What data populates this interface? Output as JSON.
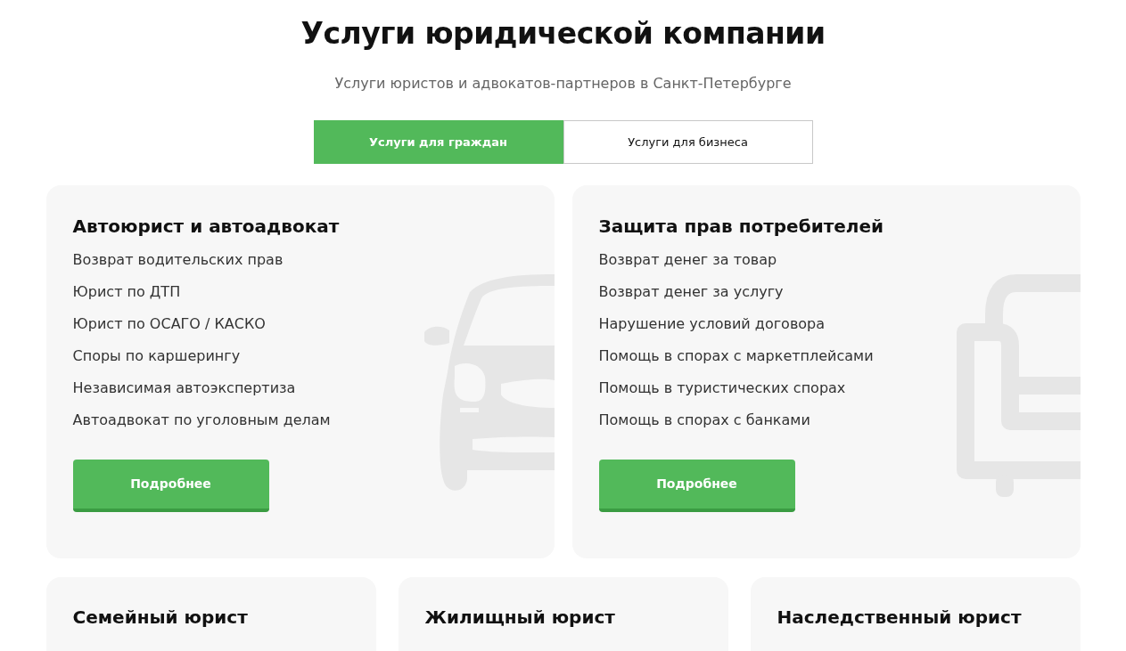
{
  "heading": "Услуги юридической компании",
  "subheading": "Услуги юристов и адвокатов-партнеров в Санкт-Петербурге",
  "tabs": [
    {
      "label": "Услуги для граждан",
      "selected": true
    },
    {
      "label": "Услуги для бизнеса",
      "selected": false
    }
  ],
  "featured_cards": [
    {
      "title": "Автоюрист и автоадвокат",
      "items": [
        "Возврат водительских прав",
        "Юрист по ДТП",
        "Юрист по ОСАГО / КАСКО",
        "Споры по каршерингу",
        "Независимая автоэкспертиза",
        "Автоадвокат по уголовным делам"
      ],
      "button": "Подробнее"
    },
    {
      "title": "Защита прав потребителей",
      "items": [
        "Возврат денег за товар",
        "Возврат денег за услугу",
        "Нарушение условий договора",
        "Помощь в спорах с маркетплейсами",
        "Помощь в туристических спорах",
        "Помощь в спорах с банками"
      ],
      "button": "Подробнее"
    }
  ],
  "more_cards": [
    {
      "title": "Семейный юрист"
    },
    {
      "title": "Жилищный юрист"
    },
    {
      "title": "Наследственный юрист"
    }
  ]
}
